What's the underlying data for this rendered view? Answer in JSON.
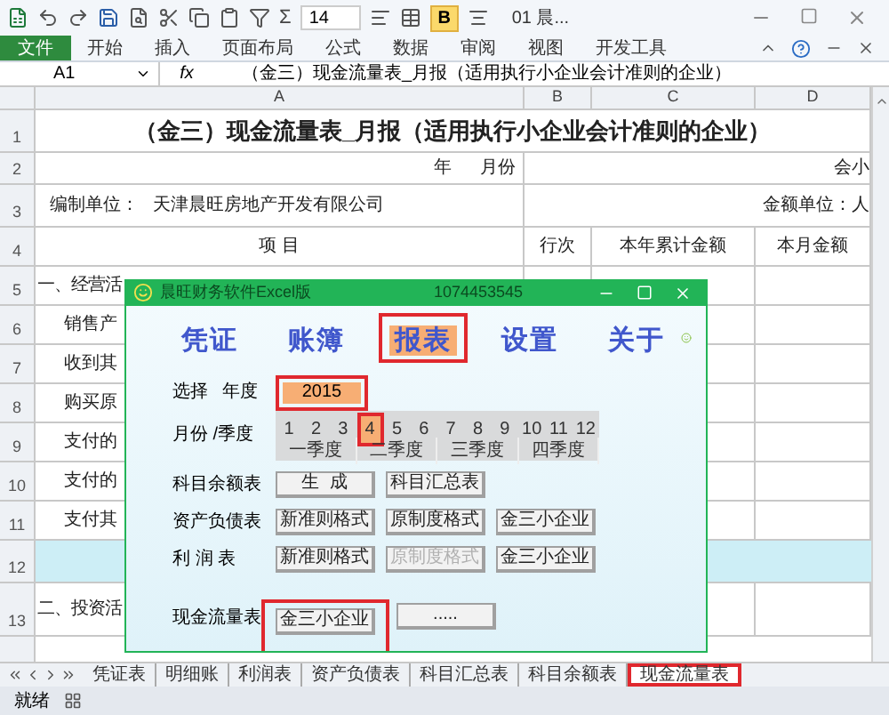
{
  "toolbar": {
    "sum_label": "Σ",
    "font_size": "14",
    "bold_label": "B",
    "title": "01 晨..."
  },
  "ribbon_tabs": [
    {
      "label": "文件",
      "kind": "file"
    },
    {
      "label": "开始",
      "kind": "tab"
    },
    {
      "label": "插入",
      "kind": "tab"
    },
    {
      "label": "页面布局",
      "kind": "tab"
    },
    {
      "label": "公式",
      "kind": "tab"
    },
    {
      "label": "数据",
      "kind": "tab"
    },
    {
      "label": "审阅",
      "kind": "tab"
    },
    {
      "label": "视图",
      "kind": "tab"
    },
    {
      "label": "开发工具",
      "kind": "tab"
    }
  ],
  "formula_bar": {
    "name_box": "A1",
    "function_label": "fx",
    "formula": "（金三）现金流量表_月报（适用执行小企业会计准则的企业）"
  },
  "sheet": {
    "columns": [
      "A",
      "B",
      "C",
      "D"
    ],
    "rows": [
      {
        "number": "1",
        "kind": "title",
        "text": "（金三）现金流量表_月报（适用执行小企业会计准则的企业）"
      },
      {
        "number": "2",
        "kind": "period",
        "year_label": "年",
        "month_label": "月份",
        "d": "会小"
      },
      {
        "number": "3",
        "kind": "unit",
        "label": "编制单位：",
        "company": "天津晨旺房地产开发有限公司",
        "d": "金额单位：人"
      },
      {
        "number": "4",
        "kind": "header",
        "a": "项 目",
        "b": "行次",
        "c": "本年累计金额",
        "d": "本月金额"
      },
      {
        "number": "5",
        "kind": "section",
        "text": "一、经营活"
      },
      {
        "number": "6",
        "kind": "item",
        "text": "销售产"
      },
      {
        "number": "7",
        "kind": "item",
        "text": "收到其"
      },
      {
        "number": "8",
        "kind": "item",
        "text": "购买原"
      },
      {
        "number": "9",
        "kind": "item",
        "text": "支付的"
      },
      {
        "number": "10",
        "kind": "item",
        "text": "支付的"
      },
      {
        "number": "11",
        "kind": "item",
        "text": "支付其"
      },
      {
        "number": "12",
        "kind": "band"
      },
      {
        "number": "13",
        "kind": "section",
        "text": "二、投资活"
      }
    ]
  },
  "sheet_tabs": [
    {
      "label": "凭证表",
      "selected": false,
      "highlighted": false
    },
    {
      "label": "明细账",
      "selected": false,
      "highlighted": false
    },
    {
      "label": "利润表",
      "selected": false,
      "highlighted": false
    },
    {
      "label": "资产负债表",
      "selected": false,
      "highlighted": false
    },
    {
      "label": "科目汇总表",
      "selected": false,
      "highlighted": false
    },
    {
      "label": "科目余额表",
      "selected": false,
      "highlighted": false
    },
    {
      "label": "现金流量表",
      "selected": true,
      "highlighted": true
    }
  ],
  "status_bar": {
    "text": "就绪"
  },
  "dialog": {
    "title": "晨旺财务软件Excel版",
    "code": "1074453545",
    "tabs": [
      {
        "label": "凭证",
        "selected": false,
        "highlighted": false
      },
      {
        "label": "账簿",
        "selected": false,
        "highlighted": false
      },
      {
        "label": "报表",
        "selected": true,
        "highlighted": true
      },
      {
        "label": "设置",
        "selected": false,
        "highlighted": false
      },
      {
        "label": "关于",
        "selected": false,
        "highlighted": false
      }
    ],
    "year_label_1": "选择",
    "year_label_2": "年度",
    "year": "2015",
    "year_highlighted": true,
    "month_label": "月份 /季度",
    "months": [
      {
        "label": "1",
        "selected": false,
        "highlighted": false
      },
      {
        "label": "2",
        "selected": false,
        "highlighted": false
      },
      {
        "label": "3",
        "selected": false,
        "highlighted": false
      },
      {
        "label": "4",
        "selected": true,
        "highlighted": true
      },
      {
        "label": "5",
        "selected": false,
        "highlighted": false
      },
      {
        "label": "6",
        "selected": false,
        "highlighted": false
      },
      {
        "label": "7",
        "selected": false,
        "highlighted": false
      },
      {
        "label": "8",
        "selected": false,
        "highlighted": false
      },
      {
        "label": "9",
        "selected": false,
        "highlighted": false
      },
      {
        "label": "10",
        "selected": false,
        "highlighted": false
      },
      {
        "label": "11",
        "selected": false,
        "highlighted": false
      },
      {
        "label": "12",
        "selected": false,
        "highlighted": false
      }
    ],
    "quarters": [
      "一季度",
      "二季度",
      "三季度",
      "四季度"
    ],
    "report_rows": [
      {
        "label": "科目余额表",
        "buttons": [
          {
            "label": "生  成",
            "disabled": false,
            "highlighted": false
          },
          {
            "label": "科目汇总表",
            "disabled": false,
            "highlighted": false
          }
        ]
      },
      {
        "label": "资产负债表",
        "buttons": [
          {
            "label": "新准则格式",
            "disabled": false,
            "highlighted": false
          },
          {
            "label": "原制度格式",
            "disabled": false,
            "highlighted": false
          },
          {
            "label": "金三小企业",
            "disabled": false,
            "highlighted": false
          }
        ]
      },
      {
        "label": "利 润 表",
        "buttons": [
          {
            "label": "新准则格式",
            "disabled": false,
            "highlighted": false
          },
          {
            "label": "原制度格式",
            "disabled": true,
            "highlighted": false
          },
          {
            "label": "金三小企业",
            "disabled": false,
            "highlighted": false
          }
        ]
      },
      {
        "label": "现金流量表",
        "buttons": [
          {
            "label": "金三小企业",
            "disabled": false,
            "highlighted": true
          },
          {
            "label": ".....",
            "disabled": false,
            "highlighted": false
          }
        ]
      }
    ]
  }
}
